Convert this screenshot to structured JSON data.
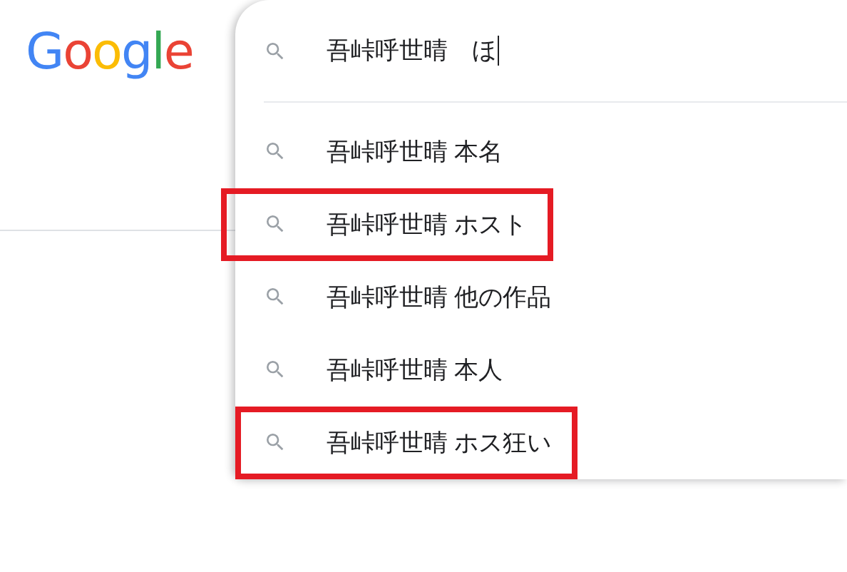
{
  "logo": {
    "text": "Google"
  },
  "search": {
    "value": "吾峠呼世晴　ほ"
  },
  "suggestions": [
    {
      "text": "吾峠呼世晴 本名",
      "highlighted": false
    },
    {
      "text": "吾峠呼世晴 ホスト",
      "highlighted": true
    },
    {
      "text": "吾峠呼世晴 他の作品",
      "highlighted": false
    },
    {
      "text": "吾峠呼世晴 本人",
      "highlighted": false
    },
    {
      "text": "吾峠呼世晴 ホス狂い",
      "highlighted": true
    }
  ]
}
